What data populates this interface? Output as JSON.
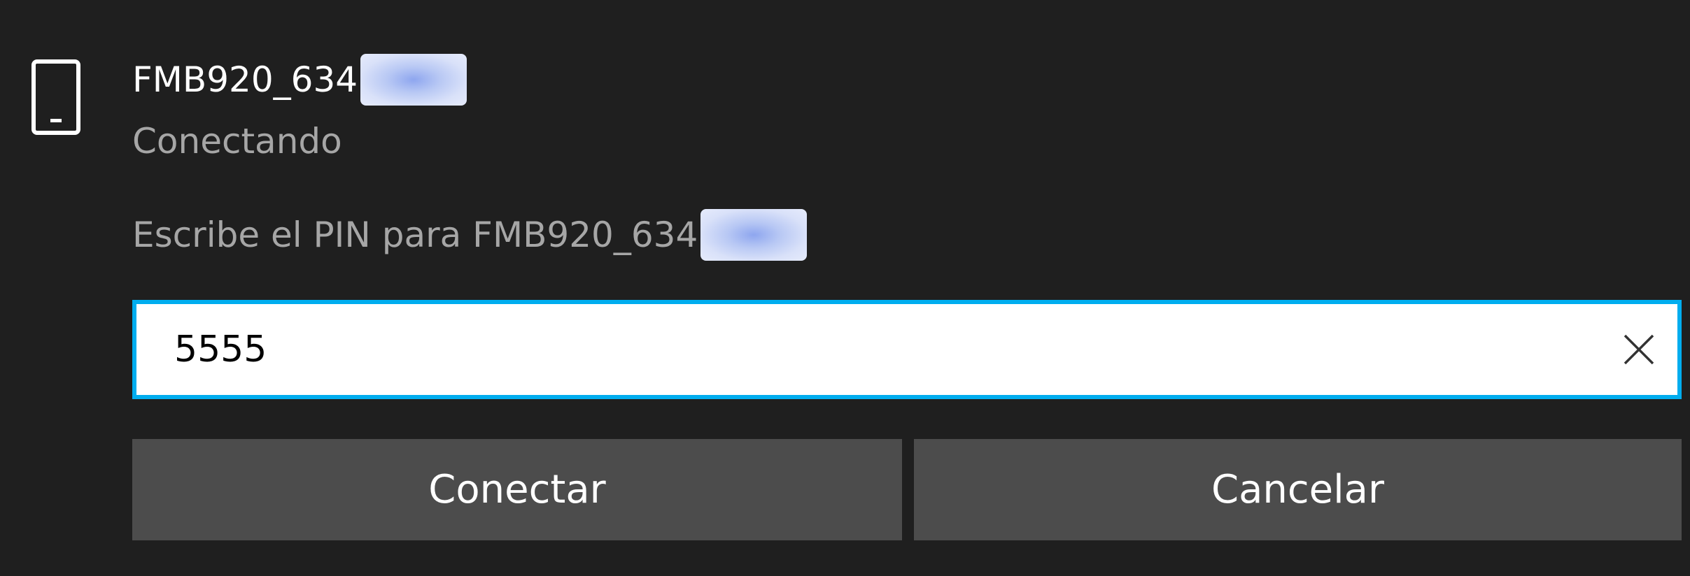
{
  "device": {
    "icon": "phone-device-icon",
    "name_prefix": "FMB920_634",
    "status": "Conectando"
  },
  "pin": {
    "prompt_prefix": "Escribe el PIN para FMB920_634",
    "value": "5555",
    "clear_icon": "close-icon"
  },
  "actions": {
    "connect_label": "Conectar",
    "cancel_label": "Cancelar"
  },
  "colors": {
    "background": "#1f1f1f",
    "focus_border": "#00adef",
    "button_bg": "#4c4c4c",
    "secondary_text": "#a6a6a6"
  }
}
